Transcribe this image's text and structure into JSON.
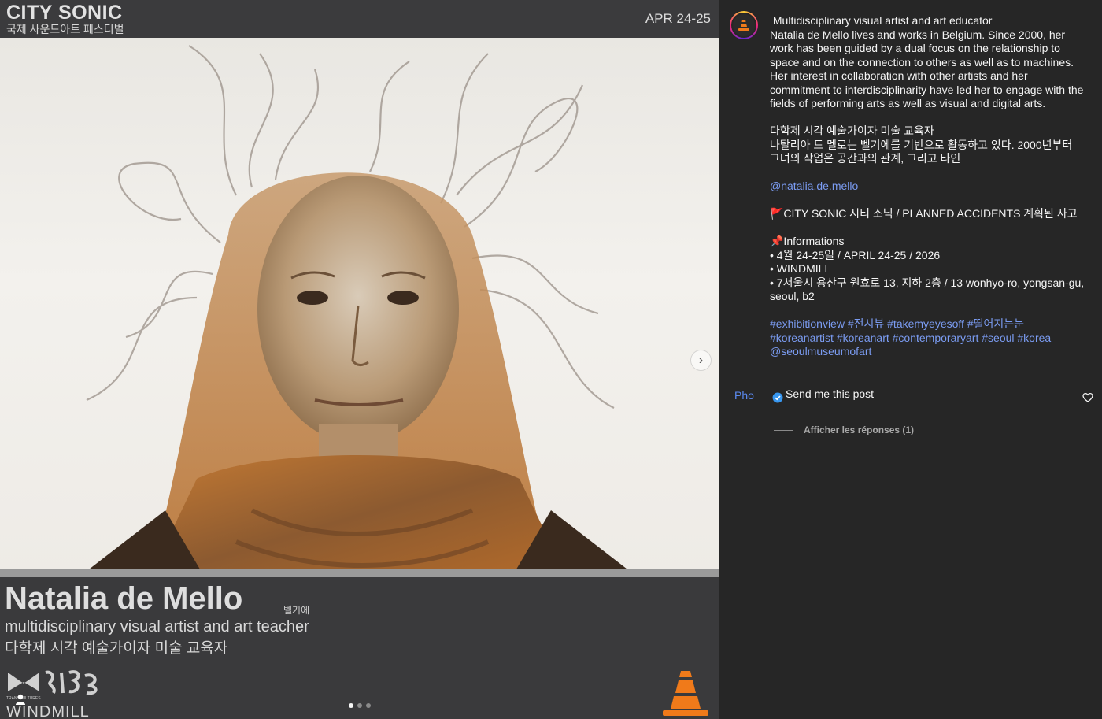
{
  "media": {
    "brand": "CITY SONIC",
    "brand_ko": "국제 사운드아트 페스티벌",
    "date": "APR 24-25",
    "artist_name": "Natalia de Mello",
    "artist_origin": "벨기에",
    "role_en": "multidisciplinary visual artist and art teacher",
    "role_ko": "다학제 시각 예술가이자 미술 교육자",
    "logo_text": "WINDMILL",
    "logo_small": "TRANSCULTURES",
    "carousel": {
      "slides": 3,
      "active": 1
    },
    "icons": {
      "next": "chevron-right-icon",
      "tag": "user-tag-icon",
      "cone": "traffic-cone-icon"
    },
    "colors": {
      "cone": "#f07a1a",
      "photo_tint": "#c8782a"
    }
  },
  "caption": {
    "lines_en": [
      " Multidisciplinary visual artist and art educator",
      "Natalia de Mello lives and works in Belgium. Since 2000, her work has been guided by a dual focus on the relationship to space and on the connection to others as well as to machines. Her interest in collaboration with other artists and her commitment to interdisciplinarity have led her to engage with the fields of performing arts as well as visual and digital arts."
    ],
    "lines_ko": [
      "다학제 시각 예술가이자 미술 교육자",
      "나탈리아 드 멜로는 벨기에를 기반으로 활동하고 있다. 2000년부터 그녀의 작업은 공간과의 관계, 그리고 타인"
    ],
    "mention": "@natalia.de.mello",
    "event_line": "🚩CITY SONIC 시티 소닉 / PLANNED ACCIDENTS 계획된 사고",
    "info_title": "📌Informations",
    "info_items": [
      "• 4월 24-25일 / APRIL 24-25 / 2026",
      "• WINDMILL",
      "• 7서울시 용산구 원효로 13, 지하 2층 / 13 wonhyo-ro, yongsan-gu, seoul, b2"
    ],
    "hashtags": "#exhibitionview #전시뷰 #takemyeyesoff #떨어지는눈 #koreanartist #koreanart #contemporaryart #seoul #korea @seoulmuseumofart"
  },
  "comment": {
    "author_avatar_text": "Pho",
    "text": "Send me this post",
    "replies": "Afficher les réponses (1)",
    "icons": {
      "verified": "verified-icon",
      "like": "heart-icon"
    }
  },
  "colors": {
    "link": "#7b9cf2",
    "panel_bg": "#262626"
  }
}
